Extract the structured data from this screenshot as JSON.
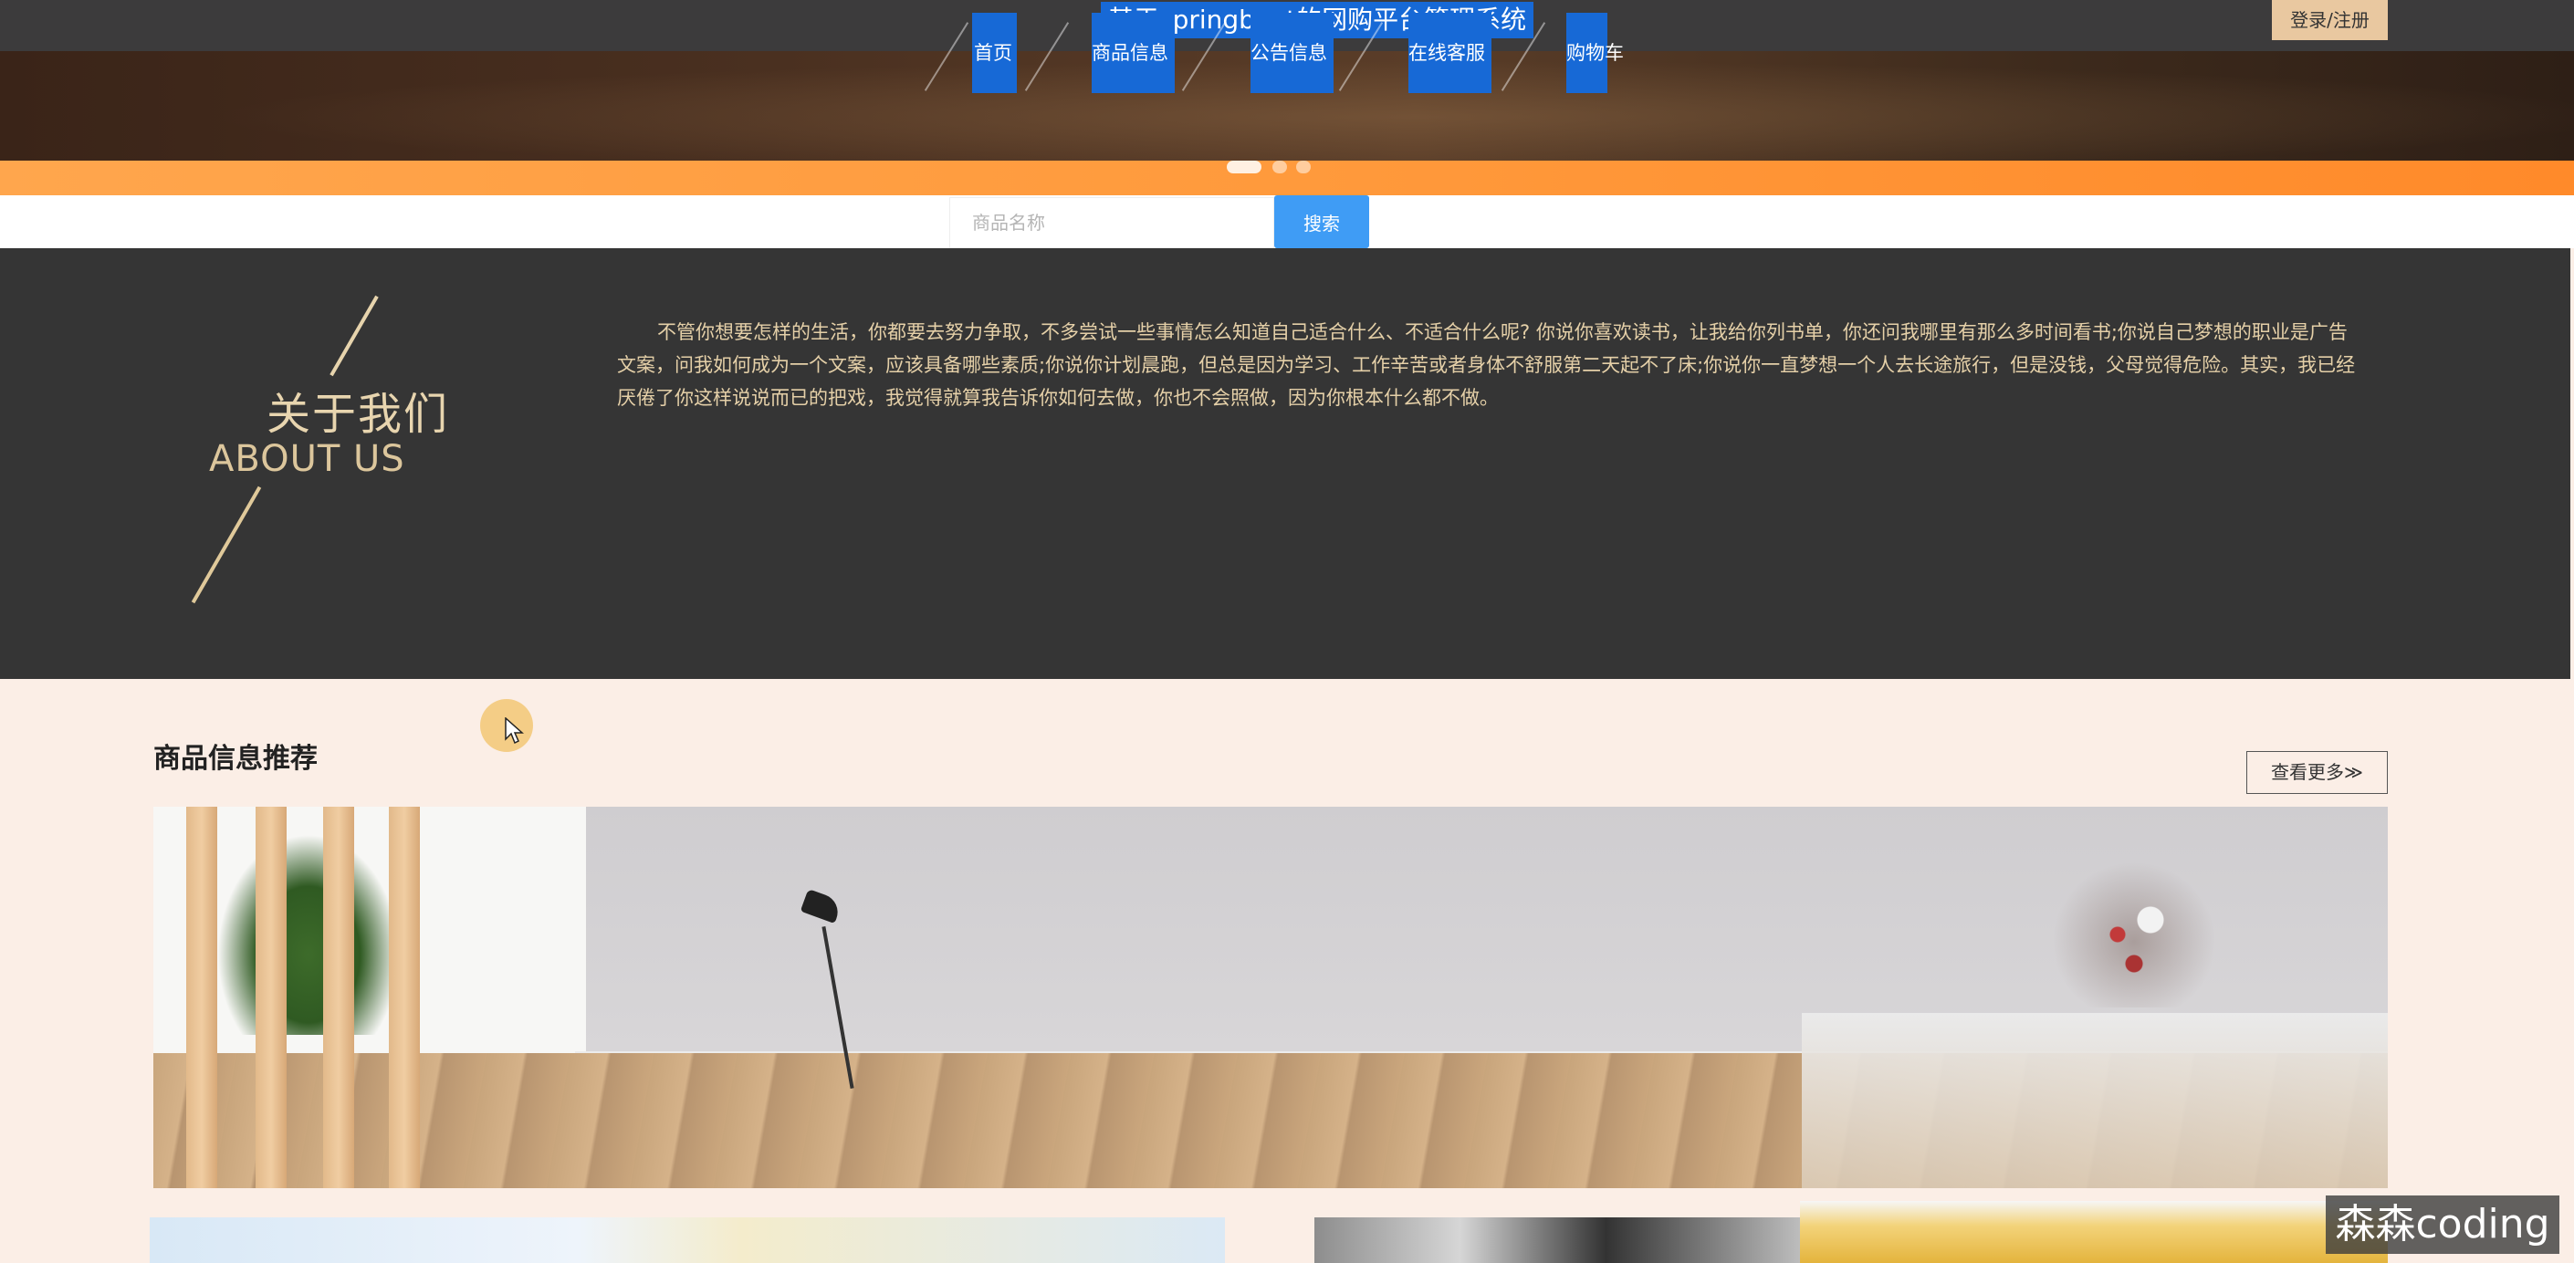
{
  "header": {
    "site_title": "基于springboot的网购平台管理系统",
    "login_label": "登录/注册"
  },
  "nav": {
    "items": [
      {
        "label": "首页"
      },
      {
        "label": "商品信息"
      },
      {
        "label": "公告信息"
      },
      {
        "label": "在线客服"
      },
      {
        "label": "购物车"
      }
    ]
  },
  "search": {
    "placeholder": "商品名称",
    "button_label": "搜索"
  },
  "about": {
    "title_cn": "关于我们",
    "title_en": "ABOUT US",
    "text": "不管你想要怎样的生活，你都要去努力争取，不多尝试一些事情怎么知道自己适合什么、不适合什么呢? 你说你喜欢读书，让我给你列书单，你还问我哪里有那么多时间看书;你说自己梦想的职业是广告文案，问我如何成为一个文案，应该具备哪些素质;你说你计划晨跑，但总是因为学习、工作辛苦或者身体不舒服第二天起不了床;你说你一直梦想一个人去长途旅行，但是没钱，父母觉得危险。其实，我已经厌倦了你这样说说而已的把戏，我觉得就算我告诉你如何去做，你也不会照做，因为你根本什么都不做。"
  },
  "products": {
    "section_title": "商品信息推荐",
    "more_label": "查看更多≫"
  },
  "watermark": "森森coding",
  "colors": {
    "nav_active": "#1769d6",
    "search_button": "#3f9cf5",
    "accent_orange": "#ff9a3c",
    "about_bg": "#353535",
    "about_text": "#e5d0a8"
  }
}
